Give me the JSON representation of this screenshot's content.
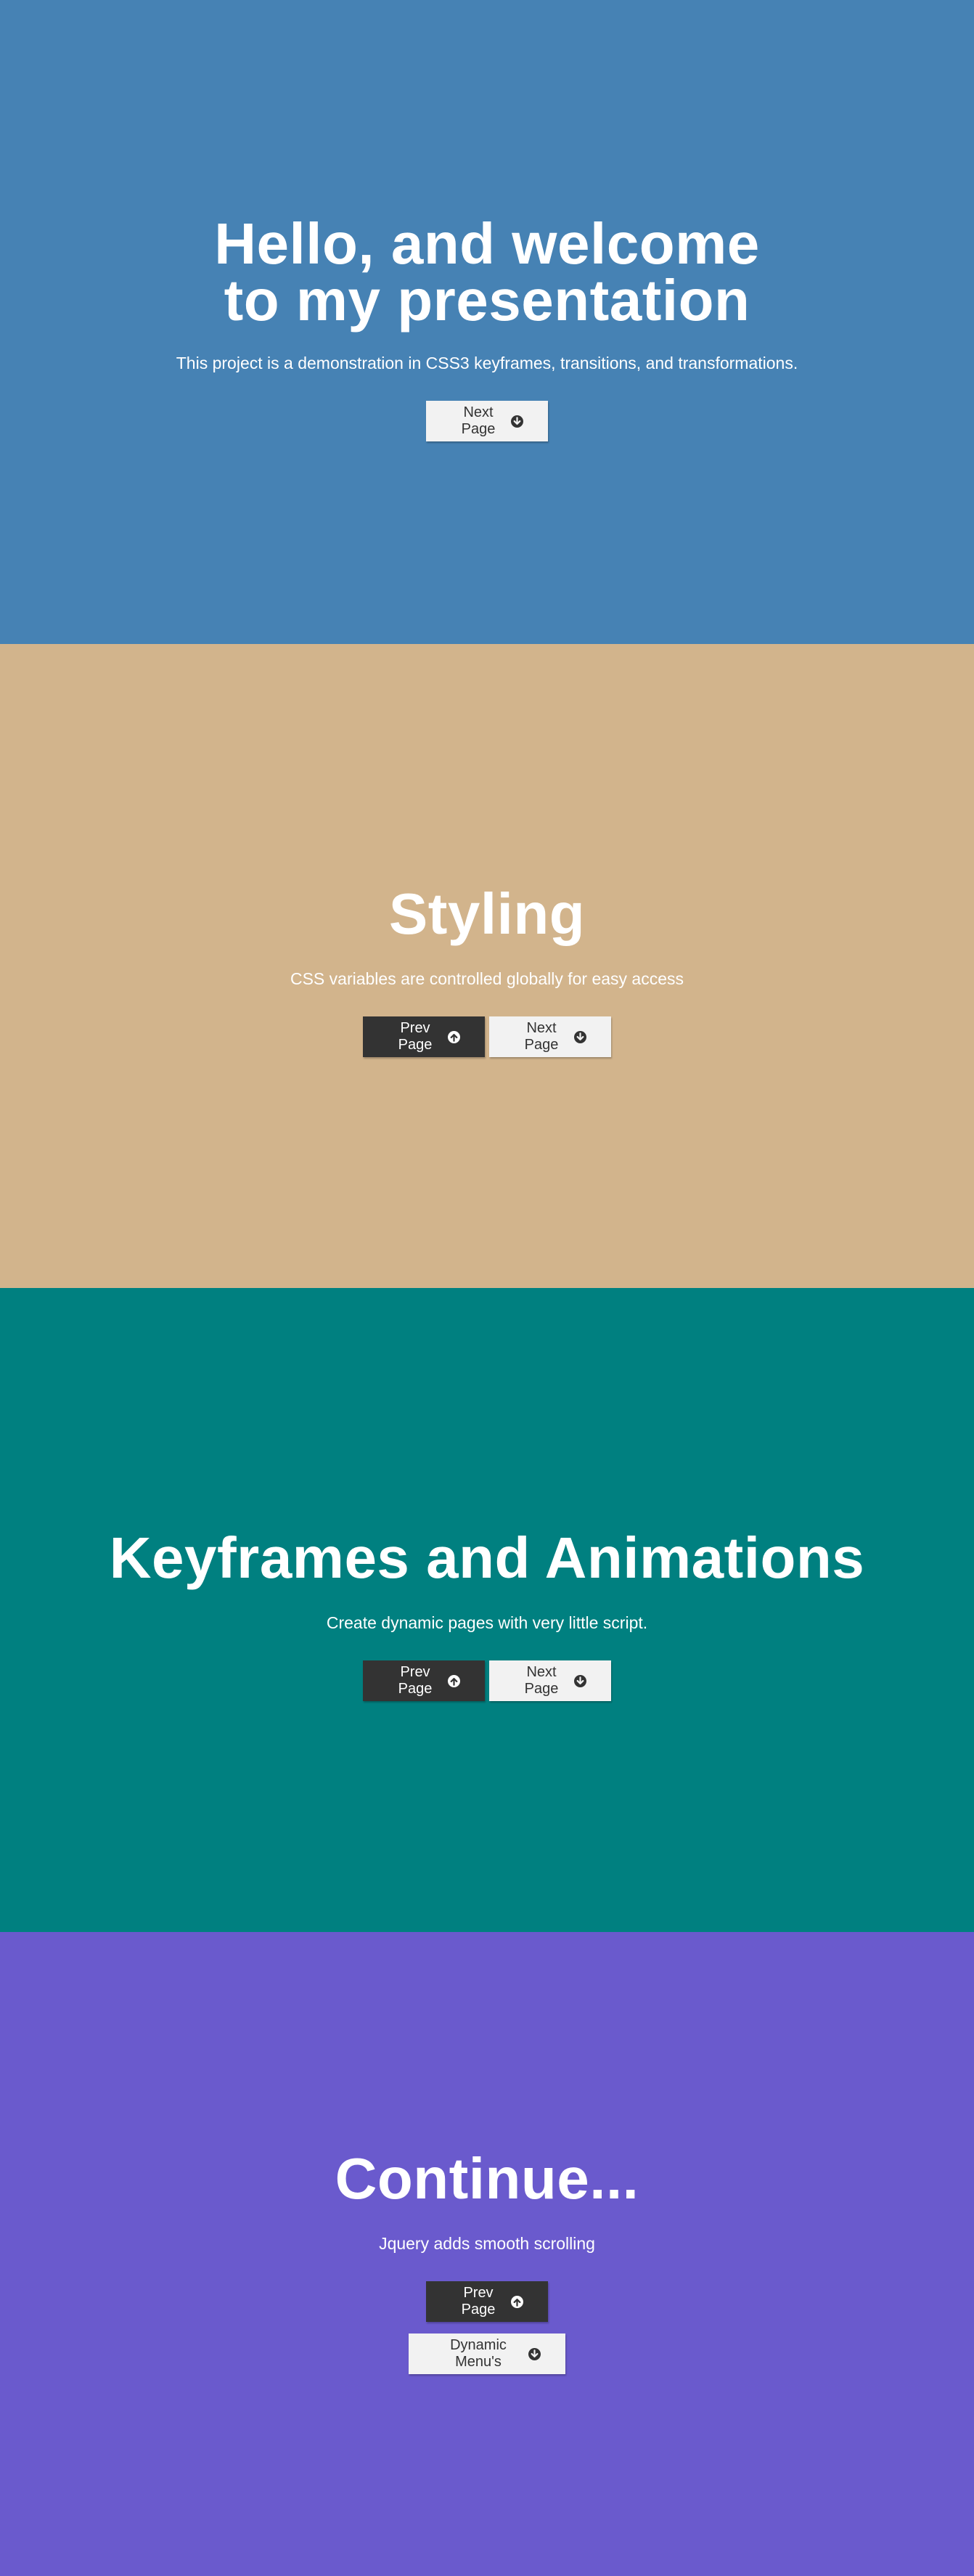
{
  "colors": {
    "section1_bg": "#4682b4",
    "section2_bg": "#d2b48c",
    "section3_bg": "#008080",
    "section4_bg": "#6a5acd",
    "button_light": "#f2f2f2",
    "button_dark": "#333333"
  },
  "sections": [
    {
      "title": "Hello, and welcome to my presentation",
      "subtitle": "This project is a demonstration in CSS3 keyframes, transitions, and transformations.",
      "next_label": "Next Page"
    },
    {
      "title": "Styling",
      "subtitle": "CSS variables are controlled globally for easy access",
      "prev_label": "Prev Page",
      "next_label": "Next Page"
    },
    {
      "title": "Keyframes and Animations",
      "subtitle": "Create dynamic pages with very little script.",
      "prev_label": "Prev Page",
      "next_label": "Next Page"
    },
    {
      "title": "Continue...",
      "subtitle": "Jquery adds smooth scrolling",
      "prev_label": "Prev Page",
      "menu_label": "Dynamic Menu's"
    }
  ],
  "icons": {
    "next": "arrow-circle-down-icon",
    "prev": "arrow-circle-up-icon"
  }
}
